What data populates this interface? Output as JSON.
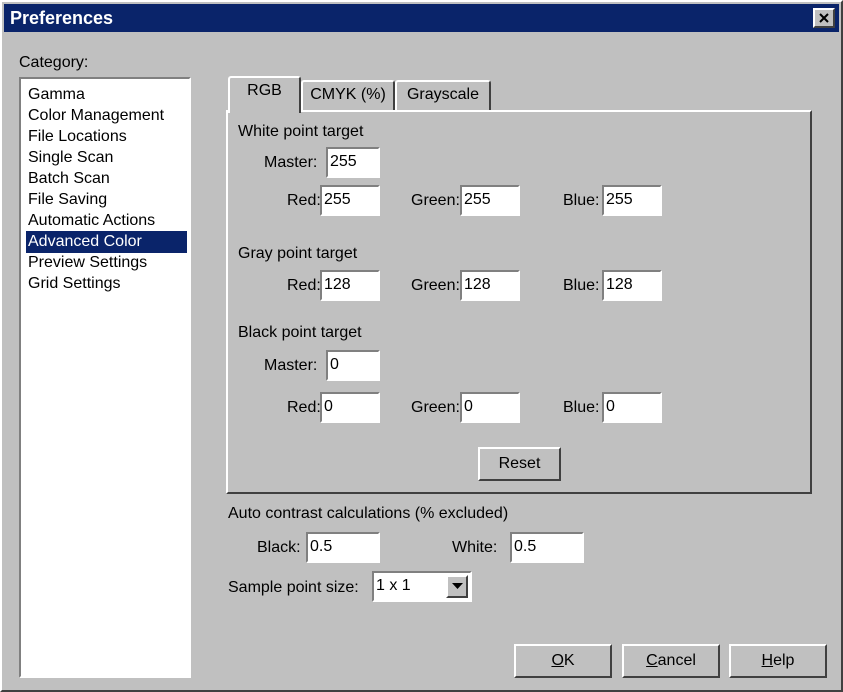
{
  "window": {
    "title": "Preferences"
  },
  "category": {
    "label": "Category:",
    "items": [
      "Gamma",
      "Color Management",
      "File Locations",
      "Single Scan",
      "Batch Scan",
      "File Saving",
      "Automatic Actions",
      "Advanced Color",
      "Preview Settings",
      "Grid Settings"
    ],
    "selected": "Advanced Color"
  },
  "tabs": [
    {
      "label": "RGB",
      "active": true
    },
    {
      "label": "CMYK (%)",
      "active": false
    },
    {
      "label": "Grayscale",
      "active": false
    }
  ],
  "white_point": {
    "heading": "White point target",
    "master_label": "Master:",
    "master": "255",
    "red_label": "Red:",
    "red": "255",
    "green_label": "Green:",
    "green": "255",
    "blue_label": "Blue:",
    "blue": "255"
  },
  "gray_point": {
    "heading": "Gray point target",
    "red_label": "Red:",
    "red": "128",
    "green_label": "Green:",
    "green": "128",
    "blue_label": "Blue:",
    "blue": "128"
  },
  "black_point": {
    "heading": "Black point target",
    "master_label": "Master:",
    "master": "0",
    "red_label": "Red:",
    "red": "0",
    "green_label": "Green:",
    "green": "0",
    "blue_label": "Blue:",
    "blue": "0"
  },
  "reset_label": "Reset",
  "auto_contrast": {
    "heading": "Auto contrast calculations (% excluded)",
    "black_label": "Black:",
    "black": "0.5",
    "white_label": "White:",
    "white": "0.5"
  },
  "sample_point": {
    "label": "Sample point size:",
    "value": "1 x 1"
  },
  "buttons": {
    "ok_underline": "O",
    "ok_rest": "K",
    "cancel_underline": "C",
    "cancel_rest": "ancel",
    "help_underline": "H",
    "help_rest": "elp"
  },
  "colors": {
    "titlebar": "#0a246a",
    "face": "#c0c0c0",
    "selection": "#0a246a"
  }
}
